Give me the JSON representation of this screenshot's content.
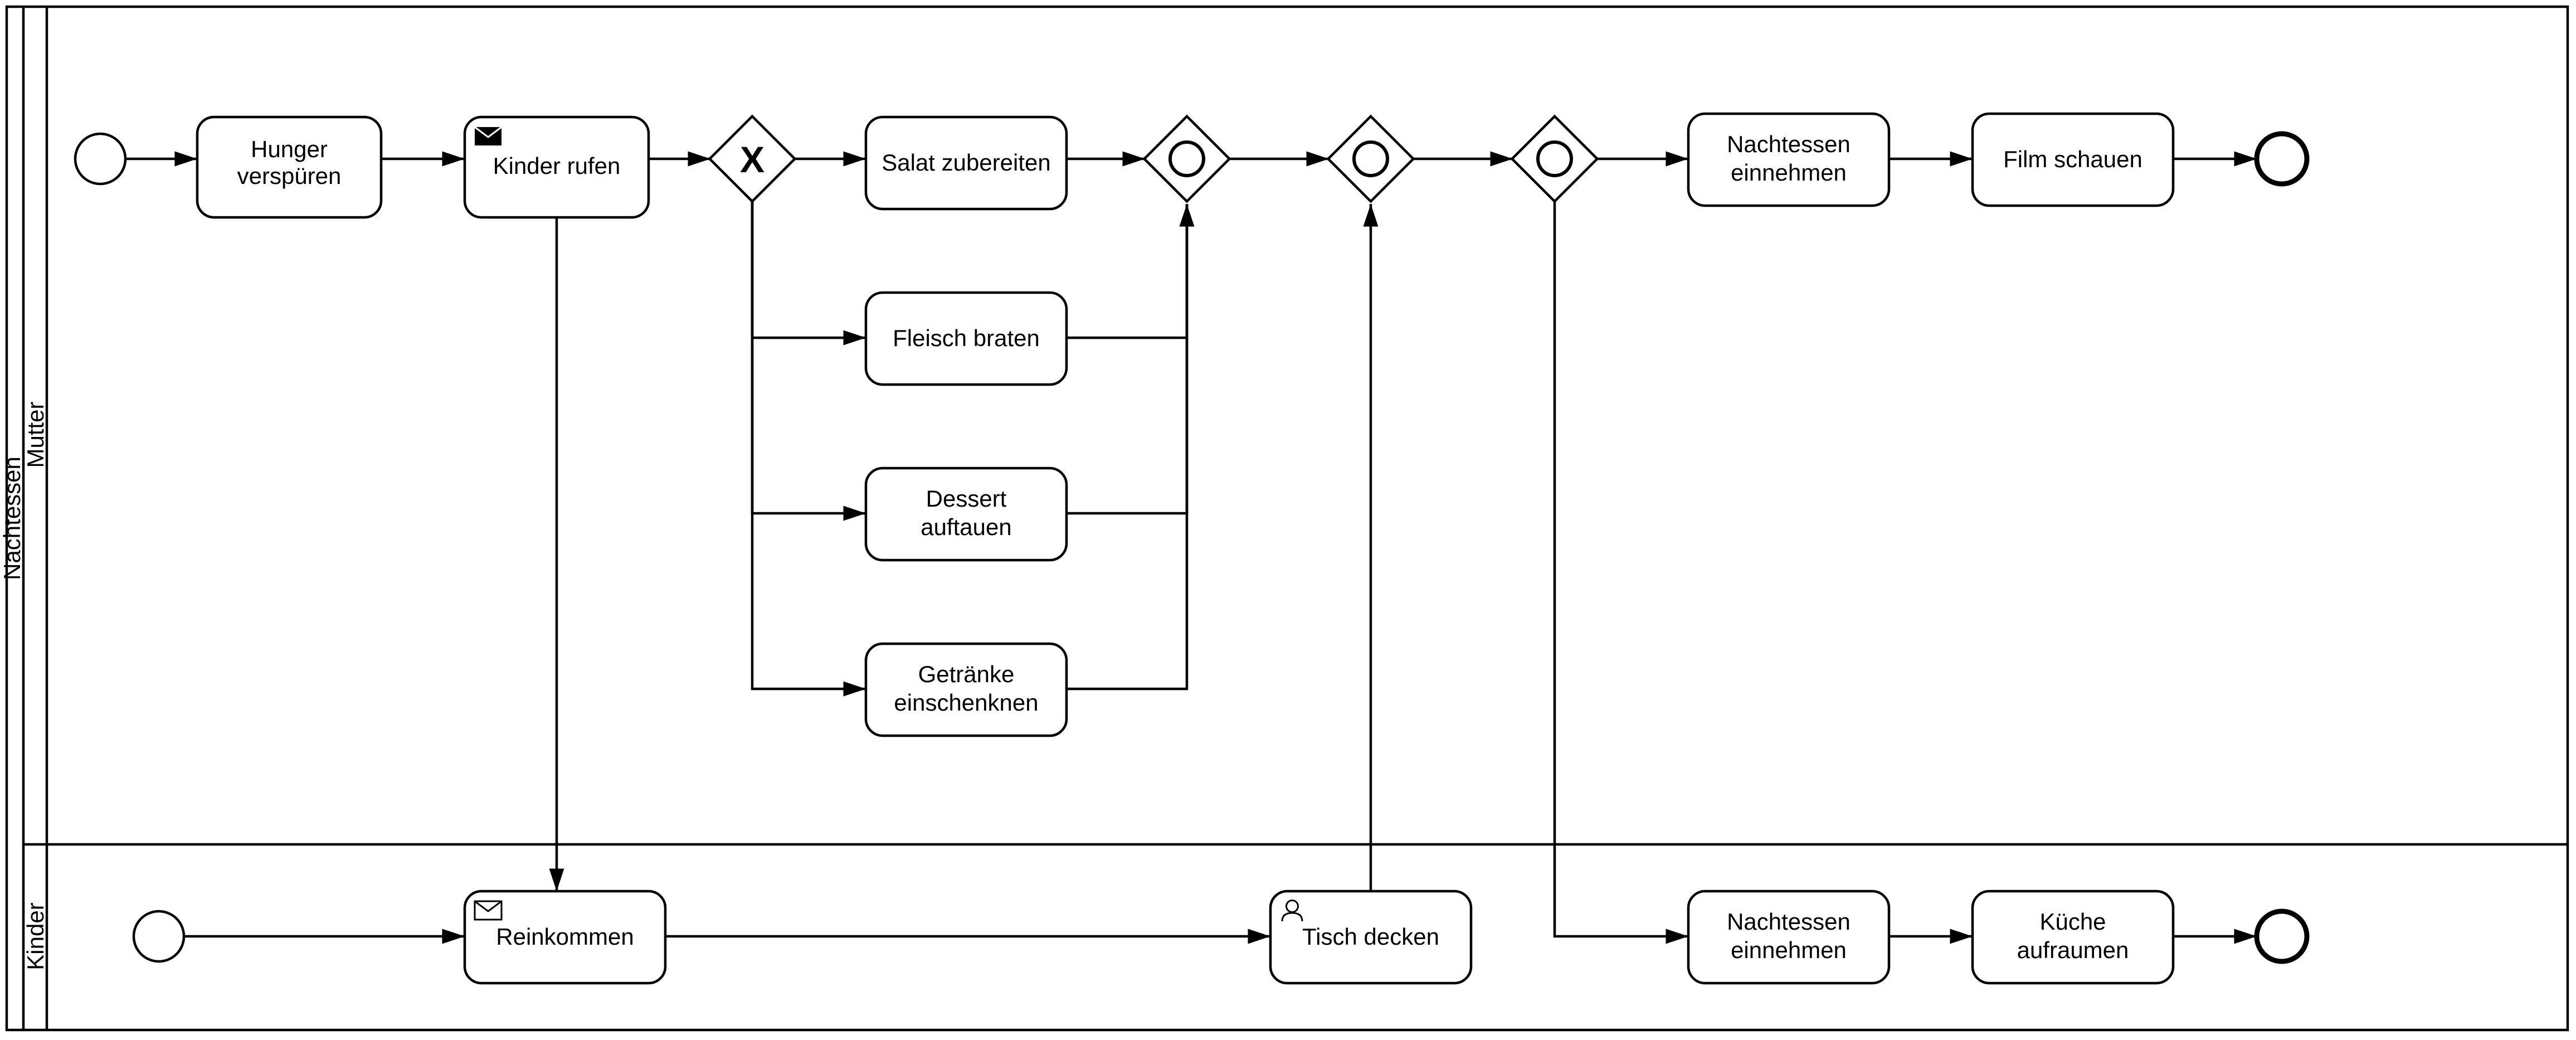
{
  "pool": {
    "title": "Nachtessen"
  },
  "lanes": {
    "top": {
      "title": "Mutter"
    },
    "bottom": {
      "title": "Kinder"
    }
  },
  "tasks": {
    "hunger": "Hunger verspüren",
    "kinder_rufen": "Kinder rufen",
    "salat": "Salat zubereiten",
    "fleisch": "Fleisch braten",
    "dessert": "Dessert auftauen",
    "getraenke": "Getränke einschenknen",
    "nachtessen_m": "Nachtessen einnehmen",
    "film": "Film schauen",
    "reinkommen": "Reinkommen",
    "tisch": "Tisch decken",
    "nachtessen_k": "Nachtessen einnehmen",
    "kueche": "Küche aufraumen"
  },
  "icons": {
    "envelope_filled": "envelope-filled-icon",
    "envelope_outline": "envelope-outline-icon",
    "user": "user-icon"
  },
  "gateway": {
    "exclusive_marker": "X"
  }
}
